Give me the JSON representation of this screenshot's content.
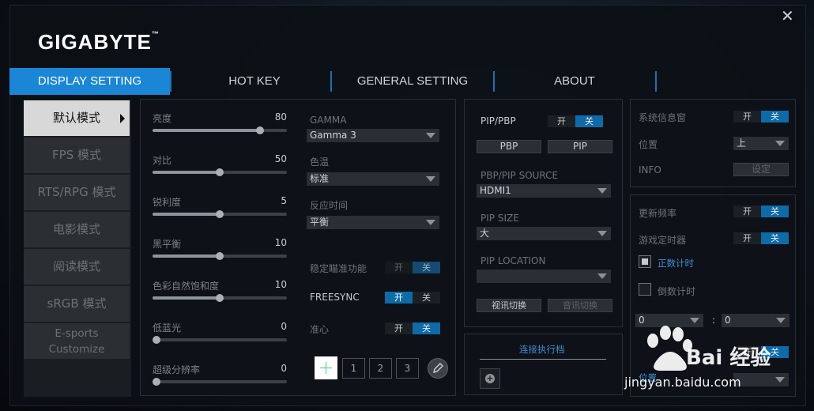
{
  "window": {
    "close_label": "✕"
  },
  "logo": {
    "text": "GIGABYTE",
    "tm": "™"
  },
  "tabs": [
    {
      "label": "DISPLAY SETTING",
      "active": true
    },
    {
      "label": "HOT KEY"
    },
    {
      "label": "GENERAL SETTING"
    },
    {
      "label": "ABOUT"
    }
  ],
  "sidebar": {
    "items": [
      {
        "label": "默认模式",
        "active": true
      },
      {
        "label": "FPS 模式"
      },
      {
        "label": "RTS/RPG 模式"
      },
      {
        "label": "电影模式"
      },
      {
        "label": "阅读模式"
      },
      {
        "label": "sRGB 模式"
      },
      {
        "label": "E-sports",
        "label2": "Customize"
      }
    ]
  },
  "sliders": [
    {
      "label": "亮度",
      "value": "80",
      "level": 0.8
    },
    {
      "label": "对比",
      "value": "50",
      "level": 0.5
    },
    {
      "label": "锐利度",
      "value": "5",
      "level": 0.5
    },
    {
      "label": "黑平衡",
      "value": "10",
      "level": 0.5
    },
    {
      "label": "色彩自然饱和度",
      "value": "10",
      "level": 0.5
    },
    {
      "label": "低蓝光",
      "value": "0",
      "level": 0.0
    },
    {
      "label": "超级分辨率",
      "value": "0",
      "level": 0.0
    }
  ],
  "picture": {
    "gamma_label": "GAMMA",
    "gamma_value": "Gamma 3",
    "color_temp_label": "色温",
    "color_temp_value": "标准",
    "response_label": "反应时间",
    "response_value": "平衡",
    "aim_stabilizer_label": "稳定瞄准功能",
    "freesync_label": "FREESYNC",
    "crosshair_label": "准心",
    "crosshair_numbers": [
      "1",
      "2",
      "3"
    ]
  },
  "toggle": {
    "on": "开",
    "off": "关"
  },
  "pip": {
    "title": "PIP/PBP",
    "pbp_button": "PBP",
    "pip_button": "PIP",
    "source_label": "PBP/PIP SOURCE",
    "source_value": "HDMI1",
    "size_label": "PIP SIZE",
    "size_value": "大",
    "location_label": "PIP LOCATION",
    "location_value": "",
    "video_switch": "视讯切换",
    "audio_switch": "音讯切换"
  },
  "shortcut": {
    "label": "连接执行档",
    "add": "+"
  },
  "system": {
    "info_window_label": "系统信息窗",
    "position_label": "位置",
    "position_value": "上",
    "info_label": "INFO",
    "settings_button": "设定"
  },
  "timer": {
    "refresh_label": "更新频率",
    "game_timer_label": "游戏定时器",
    "count_up_label": "正数计时",
    "count_down_label": "倒数计时",
    "minutes_value": "0",
    "separator": ":",
    "seconds_value": "0",
    "bottom_label": "位置"
  },
  "watermark": {
    "brand": "Bai  经验",
    "url": "jingyan.baidu.com"
  }
}
